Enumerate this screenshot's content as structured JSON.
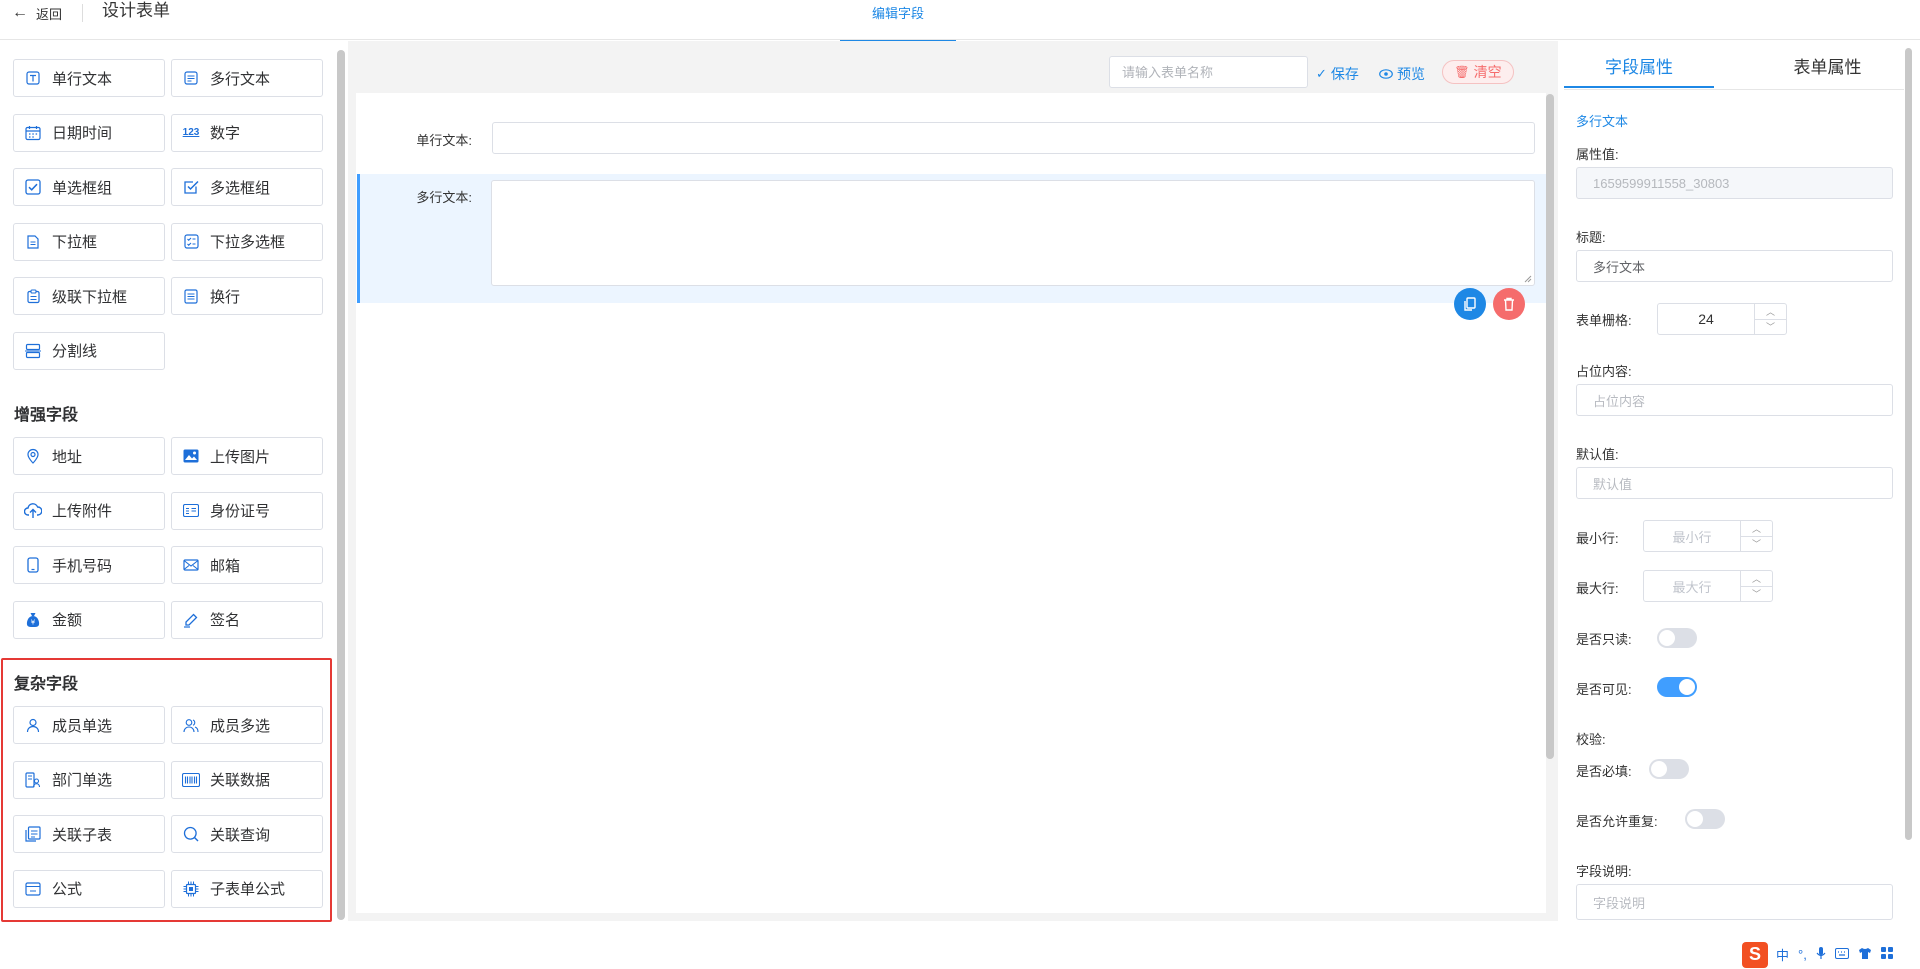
{
  "header": {
    "back_label": "返回",
    "title": "设计表单",
    "tab_edit": "编辑字段"
  },
  "left": {
    "basic_fields": [
      {
        "label": "单行文本",
        "icon": "text-icon"
      },
      {
        "label": "多行文本",
        "icon": "textarea-icon"
      },
      {
        "label": "日期时间",
        "icon": "calendar-icon"
      },
      {
        "label": "数字",
        "icon": "number-icon",
        "icon_text": "123"
      },
      {
        "label": "单选框组",
        "icon": "radio-icon"
      },
      {
        "label": "多选框组",
        "icon": "checkbox-icon"
      },
      {
        "label": "下拉框",
        "icon": "dropdown-icon"
      },
      {
        "label": "下拉多选框",
        "icon": "multi-dropdown-icon"
      },
      {
        "label": "级联下拉框",
        "icon": "cascade-icon"
      },
      {
        "label": "换行",
        "icon": "linebreak-icon"
      },
      {
        "label": "分割线",
        "icon": "divider-icon"
      }
    ],
    "enhanced_title": "增强字段",
    "enhanced_fields": [
      {
        "label": "地址",
        "icon": "location-icon"
      },
      {
        "label": "上传图片",
        "icon": "image-icon"
      },
      {
        "label": "上传附件",
        "icon": "upload-cloud-icon"
      },
      {
        "label": "身份证号",
        "icon": "id-card-icon"
      },
      {
        "label": "手机号码",
        "icon": "phone-icon"
      },
      {
        "label": "邮箱",
        "icon": "mail-icon"
      },
      {
        "label": "金额",
        "icon": "money-bag-icon"
      },
      {
        "label": "签名",
        "icon": "pen-icon"
      }
    ],
    "complex_title": "复杂字段",
    "complex_fields": [
      {
        "label": "成员单选",
        "icon": "user-icon"
      },
      {
        "label": "成员多选",
        "icon": "users-icon"
      },
      {
        "label": "部门单选",
        "icon": "department-icon"
      },
      {
        "label": "关联数据",
        "icon": "barcode-icon"
      },
      {
        "label": "关联子表",
        "icon": "subtable-icon"
      },
      {
        "label": "关联查询",
        "icon": "search-icon"
      },
      {
        "label": "公式",
        "icon": "formula-icon"
      },
      {
        "label": "子表单公式",
        "icon": "chip-icon"
      }
    ]
  },
  "toolbar": {
    "name_placeholder": "请输入表单名称",
    "save_label": "保存",
    "preview_label": "预览",
    "clear_label": "清空"
  },
  "canvas": {
    "field1_label": "单行文本:",
    "field2_label": "多行文本:"
  },
  "right": {
    "tab_field": "字段属性",
    "tab_form": "表单属性",
    "field_type": "多行文本",
    "attr_label": "属性值:",
    "attr_value": "1659599911558_30803",
    "title_label": "标题:",
    "title_value": "多行文本",
    "grid_label": "表单栅格:",
    "grid_value": "24",
    "placeholder_label": "占位内容:",
    "placeholder_value": "占位内容",
    "default_label": "默认值:",
    "default_value": "默认值",
    "min_rows_label": "最小行:",
    "min_rows_ph": "最小行",
    "max_rows_label": "最大行:",
    "max_rows_ph": "最大行",
    "readonly_label": "是否只读:",
    "readonly_on": false,
    "visible_label": "是否可见:",
    "visible_on": true,
    "validate_label": "校验:",
    "required_label": "是否必填:",
    "required_on": false,
    "repeat_label": "是否允许重复:",
    "repeat_on": false,
    "desc_label": "字段说明:",
    "desc_ph": "字段说明"
  },
  "ime": {
    "logo": "S",
    "lang": "中"
  }
}
